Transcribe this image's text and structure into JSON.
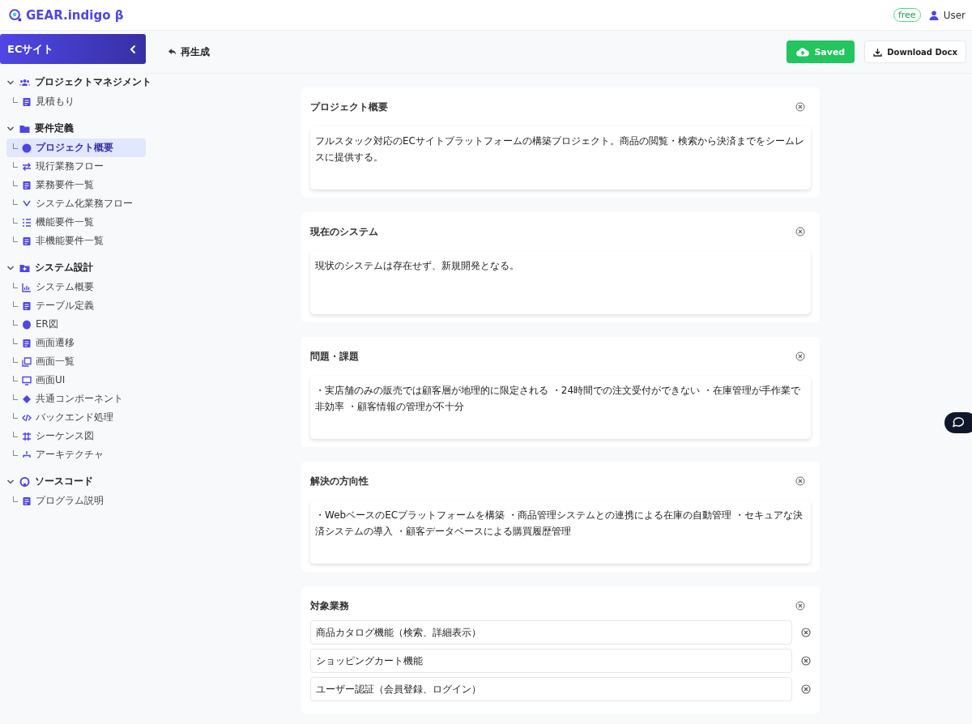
{
  "header": {
    "logo": "GEAR.indigo β",
    "plan": "free",
    "user": "User"
  },
  "sidebar": {
    "project": "ECサイト",
    "groups": [
      {
        "label": "プロジェクトマネジメント",
        "expanded": true,
        "items": [
          {
            "label": "見積もり",
            "selected": false
          }
        ]
      },
      {
        "label": "要件定義",
        "expanded": true,
        "items": [
          {
            "label": "プロジェクト概要",
            "selected": true
          },
          {
            "label": "現行業務フロー",
            "selected": false
          },
          {
            "label": "業務要件一覧",
            "selected": false
          },
          {
            "label": "システム化業務フロー",
            "selected": false
          },
          {
            "label": "機能要件一覧",
            "selected": false
          },
          {
            "label": "非機能要件一覧",
            "selected": false
          }
        ]
      },
      {
        "label": "システム設計",
        "expanded": true,
        "items": [
          {
            "label": "システム概要",
            "selected": false
          },
          {
            "label": "テーブル定義",
            "selected": false
          },
          {
            "label": "ER図",
            "selected": false
          },
          {
            "label": "画面遷移",
            "selected": false
          },
          {
            "label": "画面一覧",
            "selected": false
          },
          {
            "label": "画面UI",
            "selected": false
          },
          {
            "label": "共通コンポーネント",
            "selected": false
          },
          {
            "label": "バックエンド処理",
            "selected": false
          },
          {
            "label": "シーケンス図",
            "selected": false
          },
          {
            "label": "アーキテクチャ",
            "selected": false
          }
        ]
      },
      {
        "label": "ソースコード",
        "expanded": true,
        "items": [
          {
            "label": "プログラム説明",
            "selected": false
          }
        ]
      }
    ]
  },
  "toolbar": {
    "regenerate": "再生成",
    "saved": "Saved",
    "download": "Download Docx"
  },
  "sections": [
    {
      "kind": "text",
      "title": "プロジェクト概要",
      "value": "フルスタック対応のECサイトプラットフォームの構築プロジェクト。商品の閲覧・検索から決済までをシームレスに提供する。"
    },
    {
      "kind": "text",
      "title": "現在のシステム",
      "value": "現状のシステムは存在せず、新規開発となる。"
    },
    {
      "kind": "text",
      "title": "問題・課題",
      "value": "・実店舗のみの販売では顧客層が地理的に限定される ・24時間での注文受付ができない ・在庫管理が手作業で非効率 ・顧客情報の管理が不十分"
    },
    {
      "kind": "text",
      "title": "解決の方向性",
      "value": "・WebベースのECプラットフォームを構築 ・商品管理システムとの連携による在庫の自動管理 ・セキュアな決済システムの導入 ・顧客データベースによる購買履歴管理"
    },
    {
      "kind": "list",
      "title": "対象業務",
      "items": [
        "商品カタログ機能（検索、詳細表示）",
        "ショッピングカート機能",
        "ユーザー認証（会員登録、ログイン）"
      ]
    }
  ]
}
